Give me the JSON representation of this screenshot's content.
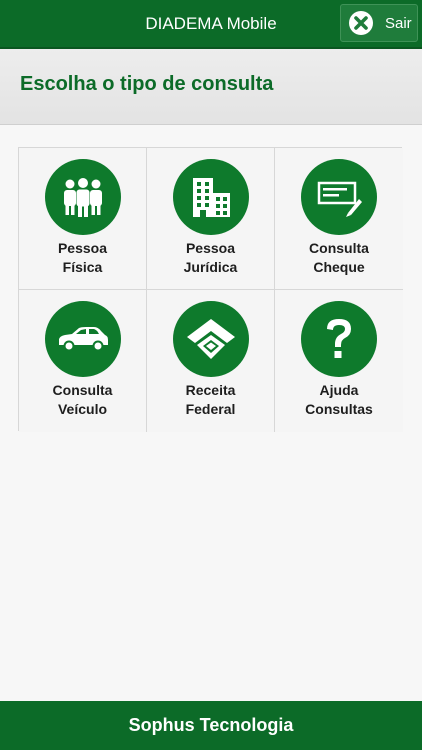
{
  "topbar": {
    "title": "DIADEMA Mobile",
    "exit_label": "Sair"
  },
  "header": {
    "title": "Escolha o tipo de consulta"
  },
  "tiles": [
    {
      "line1": "Pessoa",
      "line2": "Física",
      "icon": "people-icon"
    },
    {
      "line1": "Pessoa",
      "line2": "Jurídica",
      "icon": "buildings-icon"
    },
    {
      "line1": "Consulta",
      "line2": "Cheque",
      "icon": "check-pen-icon"
    },
    {
      "line1": "Consulta",
      "line2": "Veículo",
      "icon": "car-icon"
    },
    {
      "line1": "Receita",
      "line2": "Federal",
      "icon": "receita-federal-icon"
    },
    {
      "line1": "Ajuda",
      "line2": "Consultas",
      "icon": "question-icon"
    }
  ],
  "footer": {
    "text": "Sophus Tecnologia"
  },
  "colors": {
    "brand_green": "#0c6b28",
    "icon_green": "#0e7a2c"
  }
}
